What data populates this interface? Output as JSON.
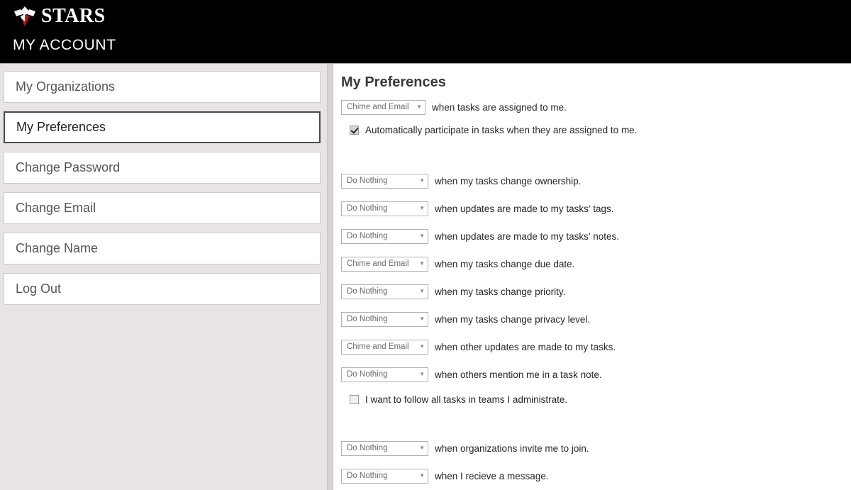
{
  "header": {
    "logo_text": "STARS",
    "logo_icon": "star-logo-icon",
    "account_title": "MY ACCOUNT",
    "background_color": "#000000",
    "logo_accent_color": "#cc1122"
  },
  "sidebar": {
    "background_color": "#e8e4e6",
    "items": [
      {
        "label": "My Organizations",
        "selected": false
      },
      {
        "label": "My Preferences",
        "selected": true
      },
      {
        "label": "Change Password",
        "selected": false
      },
      {
        "label": "Change Email",
        "selected": false
      },
      {
        "label": "Change Name",
        "selected": false
      },
      {
        "label": "Log Out",
        "selected": false
      }
    ]
  },
  "content": {
    "title": "My Preferences",
    "preferences": [
      {
        "value": "Chime and Email",
        "label": "when tasks are assigned to me."
      },
      {
        "value": "Do Nothing",
        "label": "when my tasks change ownership."
      },
      {
        "value": "Do Nothing",
        "label": "when updates are made to my tasks' tags."
      },
      {
        "value": "Do Nothing",
        "label": "when updates are made to my tasks' notes."
      },
      {
        "value": "Chime and Email",
        "label": "when my tasks change due date."
      },
      {
        "value": "Do Nothing",
        "label": "when my tasks change priority."
      },
      {
        "value": "Do Nothing",
        "label": "when my tasks change privacy level."
      },
      {
        "value": "Chime and Email",
        "label": "when other updates are made to my tasks."
      },
      {
        "value": "Do Nothing",
        "label": "when others mention me in a task note."
      },
      {
        "value": "Do Nothing",
        "label": "when organizations invite me to join."
      },
      {
        "value": "Do Nothing",
        "label": "when I recieve a message."
      }
    ],
    "checkboxes": [
      {
        "label": "Automatically participate in tasks when they are assigned to me.",
        "checked": true
      },
      {
        "label": "I want to follow all tasks in teams I administrate.",
        "checked": false
      }
    ],
    "dropdown_caret_icon": "chevron-down-icon"
  }
}
